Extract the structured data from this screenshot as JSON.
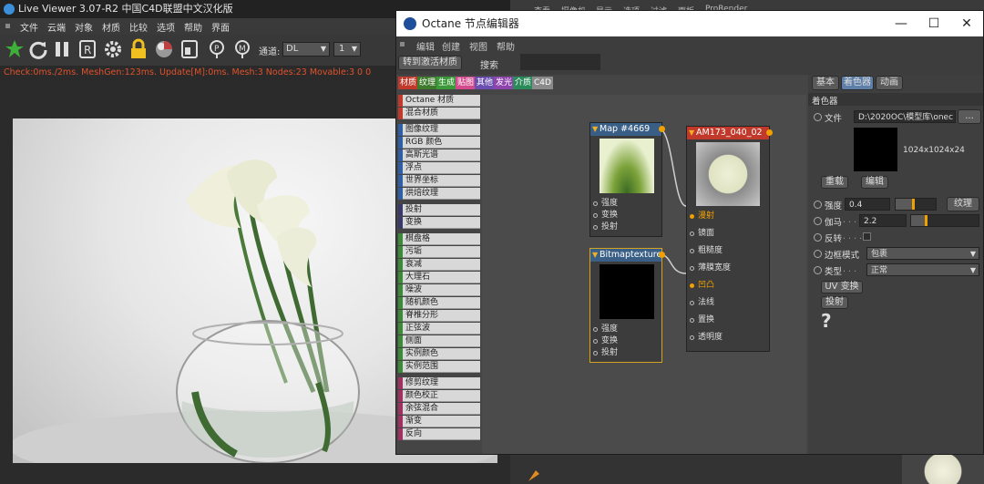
{
  "live_viewer": {
    "title": "Live Viewer 3.07-R2 中国C4D联盟中文汉化版",
    "menu": [
      "文件",
      "云端",
      "对象",
      "材质",
      "比较",
      "选项",
      "帮助",
      "界面"
    ],
    "channel_label": "通道:",
    "channel_value": "DL",
    "pass_value": "1",
    "status": "Check:0ms./2ms. MeshGen:123ms. Update[M]:0ms. Mesh:3 Nodes:23 Movable:3  0 0"
  },
  "background_app": {
    "tabs": [
      "查看",
      "摄像机",
      "显示",
      "选项",
      "过滤",
      "面板",
      "ProRender"
    ]
  },
  "octane": {
    "title": "Octane 节点编辑器",
    "menu": [
      "编辑",
      "创建",
      "视图",
      "帮助"
    ],
    "convert_button": "转到激活材质",
    "search_label": "搜索",
    "search_value": "",
    "categories": [
      {
        "label": "材质",
        "color": "#c0392b"
      },
      {
        "label": "纹理",
        "color": "#3d7a2c"
      },
      {
        "label": "生成",
        "color": "#3a9a3a"
      },
      {
        "label": "贴图",
        "color": "#d24a8c"
      },
      {
        "label": "其他",
        "color": "#6a4fb0"
      },
      {
        "label": "发光",
        "color": "#8e44ad"
      },
      {
        "label": "介质",
        "color": "#2a8a5a"
      },
      {
        "label": "C4D",
        "color": "#8a8a8a"
      }
    ],
    "node_list": [
      {
        "label": "Octane 材质",
        "color": "#c0392b"
      },
      {
        "label": "混合材质",
        "color": "#c0392b"
      },
      {
        "label": "图像纹理",
        "color": "#2e5fa5"
      },
      {
        "label": "RGB 颜色",
        "color": "#2e5fa5"
      },
      {
        "label": "高斯光谱",
        "color": "#2e5fa5"
      },
      {
        "label": "浮点",
        "color": "#2e5fa5"
      },
      {
        "label": "世界坐标",
        "color": "#2e5fa5"
      },
      {
        "label": "烘焙纹理",
        "color": "#2e5fa5"
      },
      {
        "label": "投射",
        "color": "#3a3a6a"
      },
      {
        "label": "变换",
        "color": "#3a3a6a"
      },
      {
        "label": "棋盘格",
        "color": "#3a8a3a"
      },
      {
        "label": "污垢",
        "color": "#3a8a3a"
      },
      {
        "label": "衰减",
        "color": "#3a8a3a"
      },
      {
        "label": "大理石",
        "color": "#3a8a3a"
      },
      {
        "label": "噪波",
        "color": "#3a8a3a"
      },
      {
        "label": "随机颜色",
        "color": "#3a8a3a"
      },
      {
        "label": "脊椎分形",
        "color": "#3a8a3a"
      },
      {
        "label": "正弦波",
        "color": "#3a8a3a"
      },
      {
        "label": "侧面",
        "color": "#3a8a3a"
      },
      {
        "label": "实例颜色",
        "color": "#3a8a3a"
      },
      {
        "label": "实例范围",
        "color": "#3a8a3a"
      },
      {
        "label": "修剪纹理",
        "color": "#a03060"
      },
      {
        "label": "颜色校正",
        "color": "#a03060"
      },
      {
        "label": "余弦混合",
        "color": "#a03060"
      },
      {
        "label": "渐变",
        "color": "#a03060"
      },
      {
        "label": "反向",
        "color": "#a03060"
      }
    ],
    "nodes": {
      "map": {
        "title": "Map #4669",
        "ports": [
          "强度",
          "变换",
          "投射"
        ]
      },
      "bitmap": {
        "title": "Bitmaptexture",
        "ports": [
          "强度",
          "变换",
          "投射"
        ]
      },
      "material": {
        "title": "AM173_040_02",
        "ports": [
          "漫射",
          "镜面",
          "粗糙度",
          "薄膜宽度",
          "凹凸",
          "法线",
          "置换",
          "透明度"
        ],
        "active_ports": [
          "漫射",
          "凹凸"
        ]
      }
    },
    "side_tabs": [
      "基本",
      "着色器",
      "动画"
    ],
    "side_active_tab": "着色器",
    "shader_header": "着色器",
    "file_label": "文件",
    "file_path": "D:\\2020OC\\模型库\\onec",
    "file_button": "...",
    "resolution": "1024x1024x24",
    "reload_button": "重载",
    "edit_button": "编辑",
    "power_label": "强度",
    "power_value": "0.4",
    "texture_button": "纹理",
    "gamma_label": "伽马",
    "gamma_value": "2.2",
    "invert_label": "反转",
    "border_label": "边框模式",
    "border_value": "包裹",
    "type_label": "类型",
    "type_value": "正常",
    "uv_button": "UV 变换",
    "projection_button": "投射",
    "help_symbol": "?"
  }
}
